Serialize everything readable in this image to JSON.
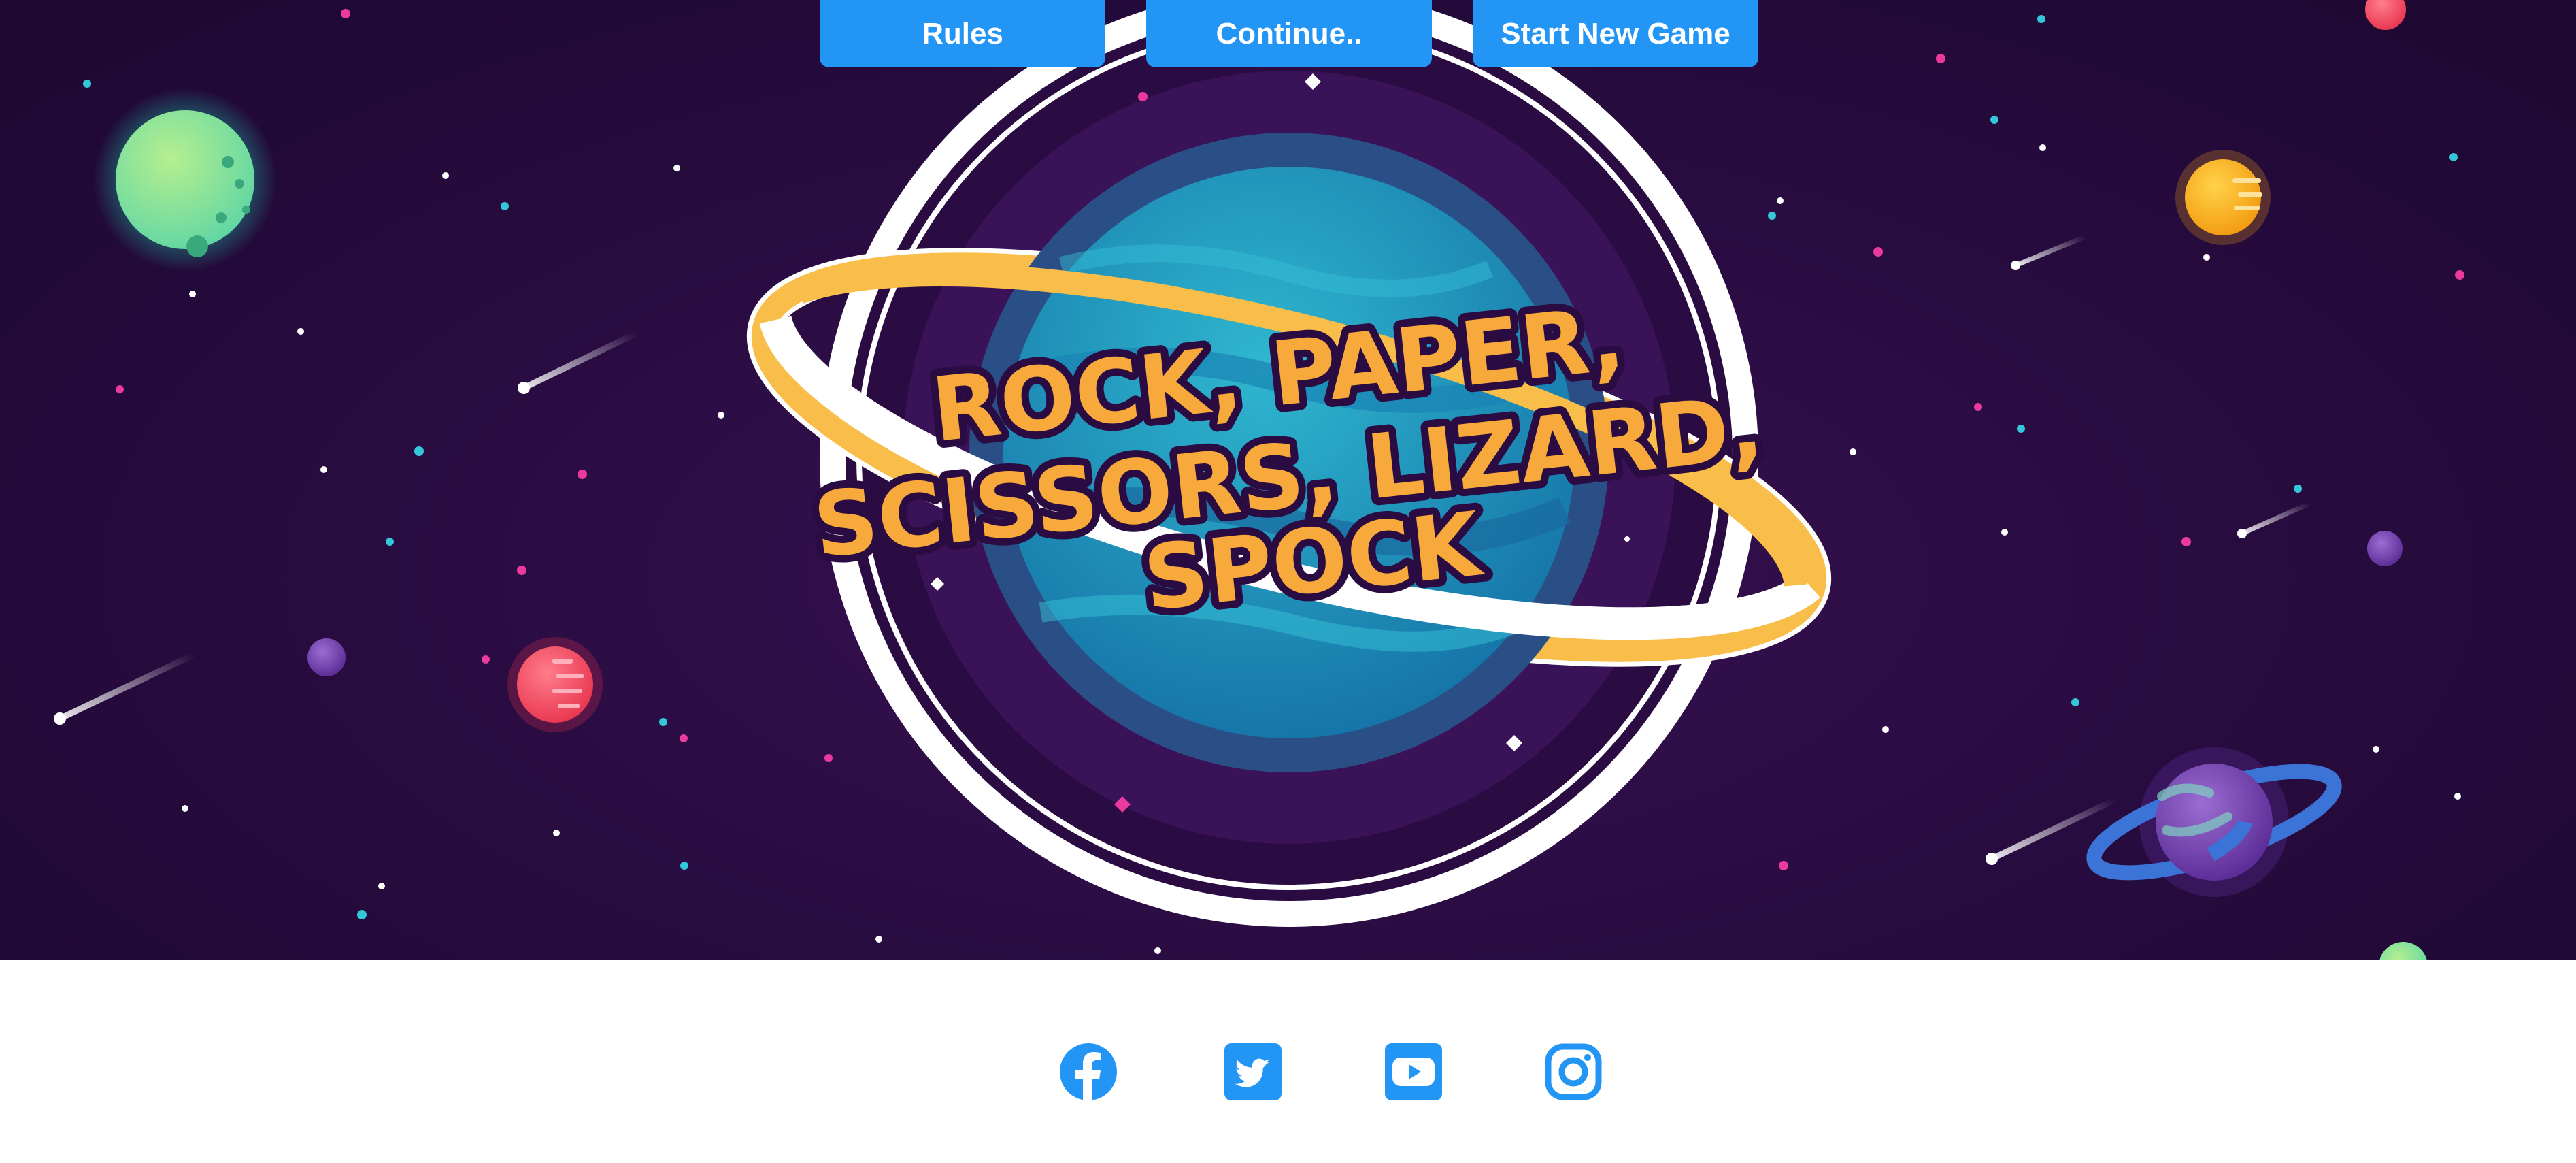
{
  "nav": {
    "rules_label": "Rules",
    "continue_label": "Continue..",
    "new_game_label": "Start New Game"
  },
  "logo": {
    "line1": "ROCK, PAPER,",
    "line2": "SCISSORS, LIZARD,",
    "line3": "SPOCK"
  },
  "social": {
    "icons": [
      "facebook-icon",
      "twitter-icon",
      "youtube-icon",
      "instagram-icon"
    ]
  },
  "colors": {
    "accent": "#2396f5",
    "title_fill": "#f7a93b",
    "title_outline": "#2a0c42",
    "ring_gold": "#f9bd4a",
    "space_bg": "#2a0c42"
  }
}
